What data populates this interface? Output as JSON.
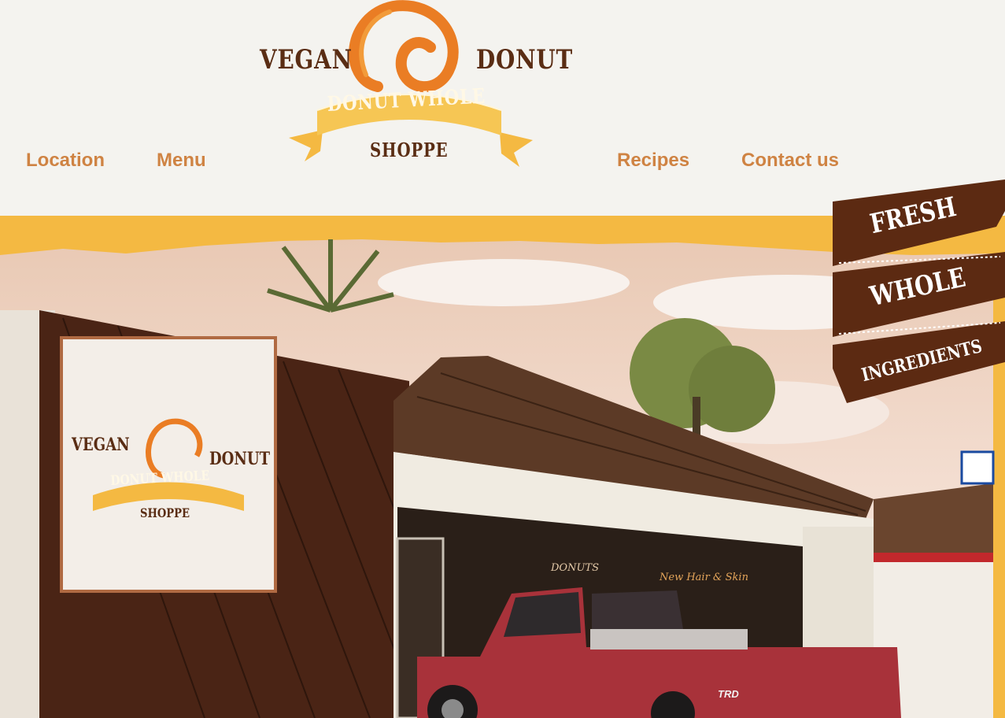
{
  "nav": {
    "left": [
      "Location",
      "Menu"
    ],
    "right": [
      "Recipes",
      "Contact us"
    ]
  },
  "logo": {
    "top_left": "VEGAN",
    "top_right": "DONUT",
    "banner": "DONUT WHOLE",
    "bottom": "SHOPPE"
  },
  "storefront": {
    "sign_left": "VEGAN",
    "sign_right": "DONUT",
    "sign_banner": "DONUT WHOLE",
    "sign_bottom": "SHOPPE",
    "window_text_1": "DONUTS",
    "window_text_2": "New Hair & Skin",
    "truck_badge": "TRD"
  },
  "badge": {
    "line1": "FRESH",
    "line2": "WHOLE",
    "line3": "INGREDIENTS"
  },
  "colors": {
    "nav_text": "#cf8343",
    "brown": "#5a2d14",
    "orange": "#ea7d24",
    "yellow": "#f4b942",
    "header_bg": "#f4f3ef"
  }
}
